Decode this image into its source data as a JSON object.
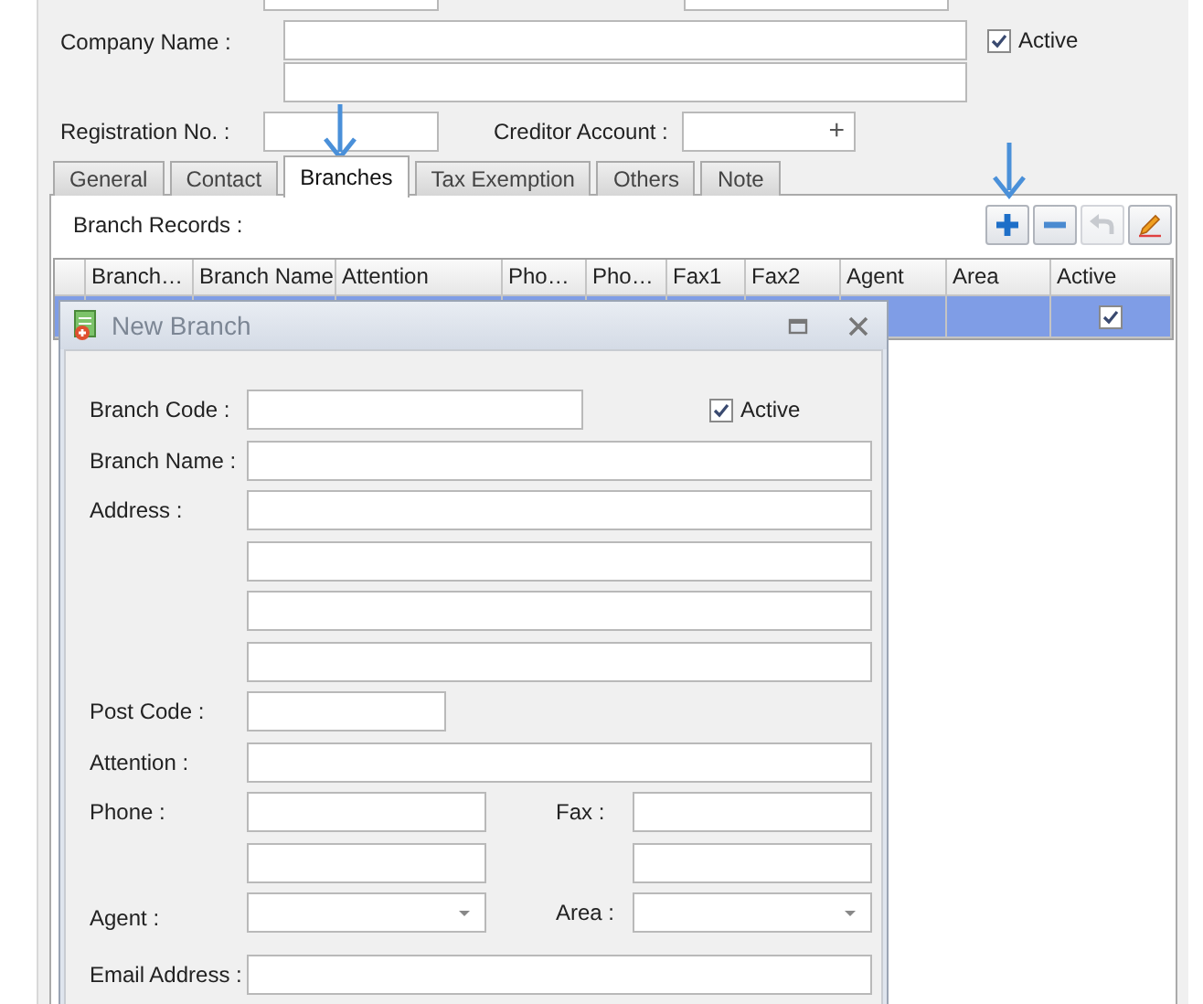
{
  "form": {
    "company_name": {
      "label": "Company Name :"
    },
    "active": {
      "label": "Active",
      "checked": true
    },
    "registration_no": {
      "label": "Registration No. :"
    },
    "creditor_account": {
      "label": "Creditor Account :",
      "button": "+"
    }
  },
  "tabs": [
    {
      "label": "General",
      "selected": false
    },
    {
      "label": "Contact",
      "selected": false
    },
    {
      "label": "Branches",
      "selected": true
    },
    {
      "label": "Tax Exemption",
      "selected": false
    },
    {
      "label": "Others",
      "selected": false
    },
    {
      "label": "Note",
      "selected": false
    }
  ],
  "branch_records": {
    "label": "Branch Records :",
    "toolbar": [
      {
        "kind": "add",
        "disabled": false
      },
      {
        "kind": "remove",
        "disabled": false
      },
      {
        "kind": "undo",
        "disabled": true
      },
      {
        "kind": "edit",
        "disabled": false
      }
    ],
    "columns": [
      "Branch…",
      "Branch Name",
      "Attention",
      "Pho…",
      "Pho…",
      "Fax1",
      "Fax2",
      "Agent",
      "Area",
      "Active"
    ],
    "rows": [
      {
        "selected": true,
        "active": true
      }
    ]
  },
  "dialog": {
    "title": "New Branch",
    "branch_code": {
      "label": "Branch Code :"
    },
    "active": {
      "label": "Active",
      "checked": true
    },
    "branch_name": {
      "label": "Branch Name :"
    },
    "address": {
      "label": "Address :"
    },
    "post_code": {
      "label": "Post Code :"
    },
    "attention": {
      "label": "Attention :"
    },
    "phone": {
      "label": "Phone :"
    },
    "fax": {
      "label": "Fax :"
    },
    "agent": {
      "label": "Agent :"
    },
    "area": {
      "label": "Area :"
    },
    "email_address": {
      "label": "Email Address :"
    }
  }
}
